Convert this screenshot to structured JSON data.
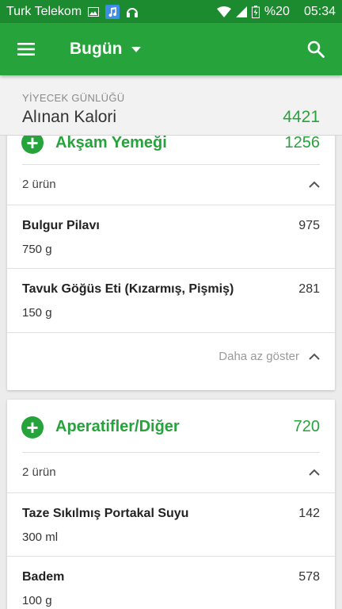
{
  "status_bar": {
    "carrier": "Turk Telekom",
    "battery": "%20",
    "time": "05:34"
  },
  "app_bar": {
    "title": "Bugün"
  },
  "summary": {
    "section_label": "YİYECEK GÜNLÜĞÜ",
    "label": "Alınan Kalori",
    "value": "4421"
  },
  "meals": [
    {
      "name": "Akşam Yemeği",
      "calories": "1256",
      "count_label": "2 ürün",
      "items": [
        {
          "name": "Bulgur Pilavı",
          "amount": "750  g",
          "calories": "975"
        },
        {
          "name": "Tavuk Göğüs Eti (Kızarmış, Pişmiş)",
          "amount": "150  g",
          "calories": "281"
        }
      ],
      "show_less_label": "Daha az göster"
    },
    {
      "name": "Aperatifler/Diğer",
      "calories": "720",
      "count_label": "2 ürün",
      "items": [
        {
          "name": "Taze Sıkılmış Portakal Suyu",
          "amount": "300  ml",
          "calories": "142"
        },
        {
          "name": "Badem",
          "amount": "100  g",
          "calories": "578"
        }
      ]
    }
  ],
  "colors": {
    "primary": "#27a33b",
    "status_bar": "#1c8a2e",
    "background": "#ececec"
  }
}
